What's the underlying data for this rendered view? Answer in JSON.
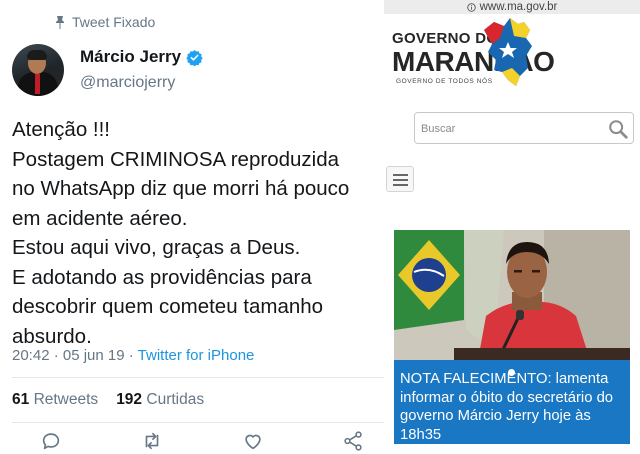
{
  "tweet": {
    "pinned_label": "Tweet Fixado",
    "author_name": "Márcio Jerry",
    "author_handle": "@marciojerry",
    "text_lines": [
      "Atenção !!!",
      "Postagem CRIMINOSA reproduzida",
      "no WhatsApp diz que morri há pouco",
      "em acidente aéreo.",
      "Estou aqui vivo, graças a Deus.",
      "E adotando as providências para",
      "descobrir quem cometeu tamanho",
      "absurdo."
    ],
    "timestamp": "20:42 · 05 jun 19 · ",
    "source": "Twitter for iPhone",
    "retweets_count": "61",
    "retweets_label": "Retweets",
    "likes_count": "192",
    "likes_label": "Curtidas",
    "actions": [
      "reply-icon",
      "retweet-icon",
      "like-icon",
      "share-icon"
    ],
    "colors": {
      "link": "#1b95e0",
      "verified": "#1da1f2",
      "muted": "#657786"
    }
  },
  "browser": {
    "url": "www.ma.gov.br",
    "logo": {
      "line1": "GOVERNO DO",
      "line2": "MARANHÃO",
      "tagline": "GOVERNO DE TODOS NÓS"
    },
    "search_placeholder": "Buscar",
    "news_caption_lines": [
      "NOTA FALECIMENTO: lamenta",
      "informar o óbito do secretário do",
      "governo Márcio Jerry hoje às",
      "18h35"
    ],
    "colors": {
      "caption_bg": "#1a77c4"
    }
  }
}
